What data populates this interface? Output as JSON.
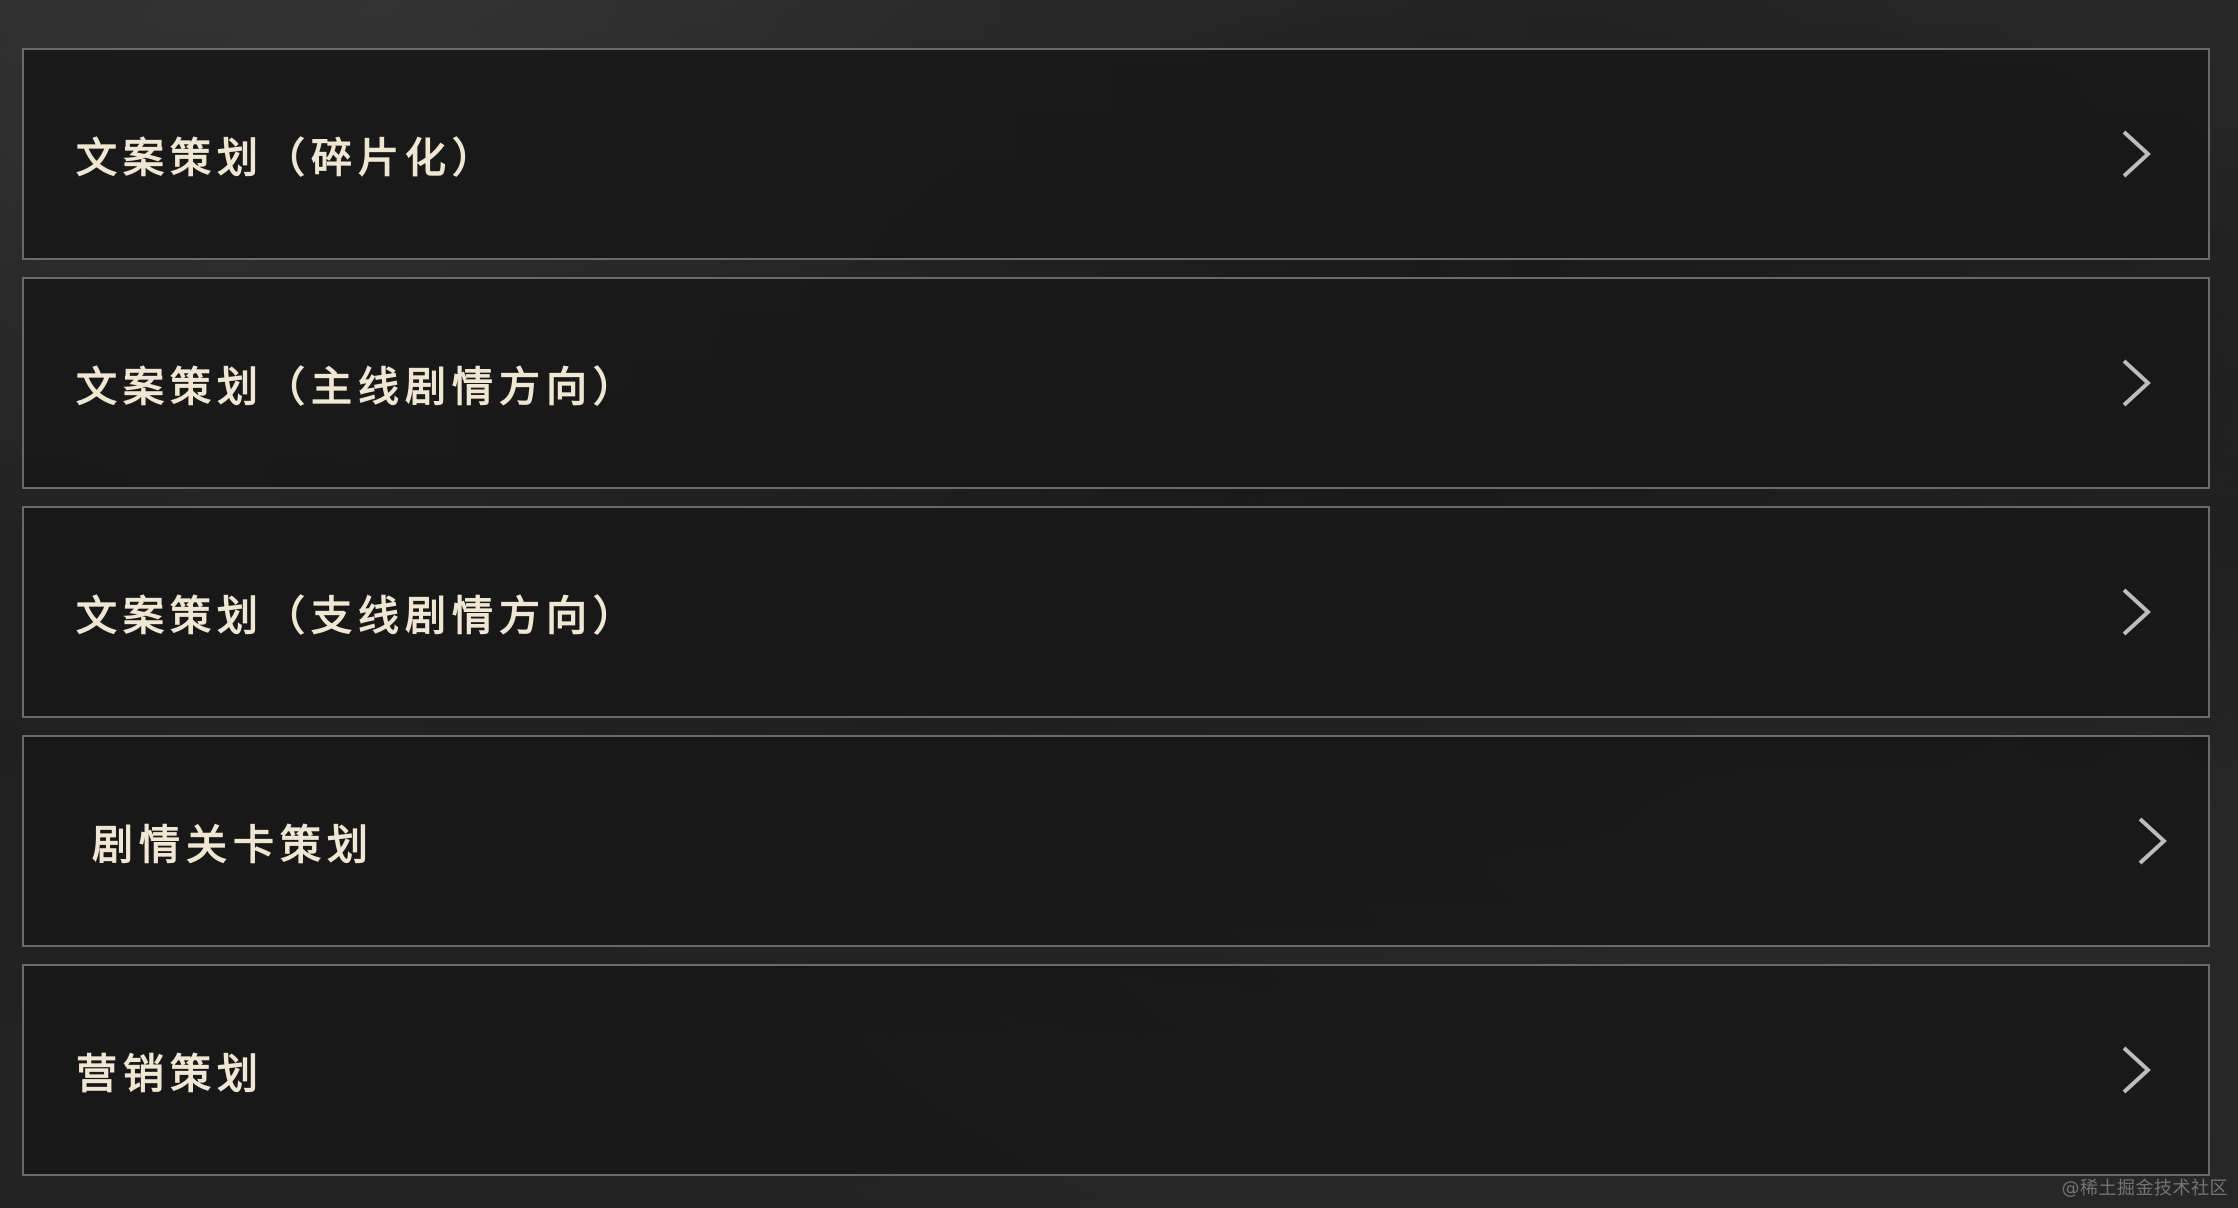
{
  "menu": {
    "items": [
      {
        "label": "文案策划（碎片化）"
      },
      {
        "label": "文案策划（主线剧情方向）"
      },
      {
        "label": "文案策划（支线剧情方向）"
      },
      {
        "label": "剧情关卡策划"
      },
      {
        "label": "营销策划"
      }
    ],
    "chevron_icon": "chevron-right-icon"
  },
  "watermark": "@稀土掘金技术社区",
  "colors": {
    "background": "#222222",
    "item_background": "#181818",
    "item_border": "#6a6a6a",
    "label_text": "#efe6d3",
    "chevron": "#bdbdbd"
  }
}
